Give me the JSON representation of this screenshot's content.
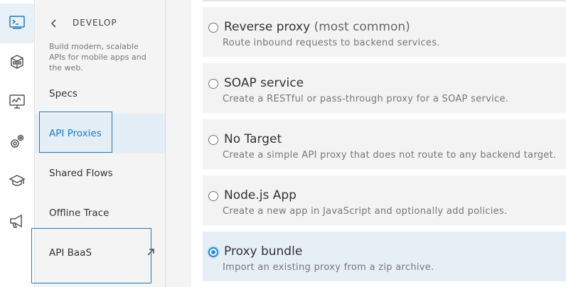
{
  "rail": {
    "items": [
      {
        "icon": "terminal-icon"
      },
      {
        "icon": "box-icon"
      },
      {
        "icon": "monitor-chart-icon"
      },
      {
        "icon": "gears-icon"
      },
      {
        "icon": "graduation-cap-icon"
      },
      {
        "icon": "megaphone-icon"
      }
    ]
  },
  "nav": {
    "title": "DEVELOP",
    "description": "Build modern, scalable APIs for mobile apps and the web.",
    "items": [
      {
        "label": "Specs"
      },
      {
        "label": "API Proxies"
      },
      {
        "label": "Shared Flows"
      },
      {
        "label": "Offline Trace"
      },
      {
        "label": "API BaaS"
      }
    ]
  },
  "options": [
    {
      "title": "Reverse proxy",
      "subtitle": "(most common)",
      "description": "Route inbound requests to backend services.",
      "checked": false
    },
    {
      "title": "SOAP service",
      "subtitle": "",
      "description": "Create a RESTful or pass-through proxy for a SOAP service.",
      "checked": false
    },
    {
      "title": "No Target",
      "subtitle": "",
      "description": "Create a simple API proxy that does not route to any backend target.",
      "checked": false
    },
    {
      "title": "Node.js App",
      "subtitle": "",
      "description": "Create a new app in JavaScript and optionally add policies.",
      "checked": false
    },
    {
      "title": "Proxy bundle",
      "subtitle": "",
      "description": "Import an existing proxy from a zip archive.",
      "checked": true
    }
  ],
  "colors": {
    "accent": "#1c7bc0",
    "radio_selected": "#2b8ad4",
    "selected_bg": "#e3eef7"
  }
}
